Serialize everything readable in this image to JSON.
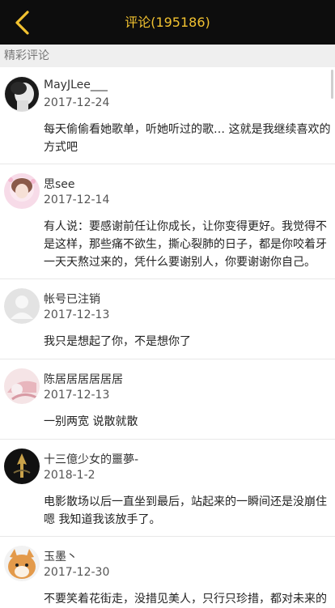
{
  "header": {
    "title": "评论(195186)",
    "back_icon": "chevron-left-icon",
    "accent_color": "#f2c230",
    "background": "#0d0d0d"
  },
  "section": {
    "title": "精彩评论"
  },
  "comments": [
    {
      "user": "MayJLee___",
      "date": "2017-12-24",
      "text": "每天偷偷看她歌单，听她听过的歌… 这就是我继续喜欢的方式吧"
    },
    {
      "user": "思see",
      "date": "2017-12-14",
      "text": "有人说：要感谢前任让你成长，让你变得更好。我觉得不是这样，那些痛不欲生，撕心裂肺的日子，都是你咬着牙一天天熬过来的，凭什么要谢别人，你要谢谢你自己。"
    },
    {
      "user": "帐号已注销",
      "date": "2017-12-13",
      "text": "我只是想起了你，不是想你了"
    },
    {
      "user": "陈居居居居居居",
      "date": "2017-12-13",
      "text": "一别两宽 说散就散"
    },
    {
      "user": "十三億少女的噩夢-",
      "date": "2018-1-2",
      "text": "电影散场以后一直坐到最后，站起来的一瞬间还是没崩住嗯 我知道我该放手了。"
    },
    {
      "user": "玉墨丶",
      "date": "2017-12-30",
      "text": "不要笑着花街走，没措见美人，只行只珍措，都对未来的"
    }
  ]
}
